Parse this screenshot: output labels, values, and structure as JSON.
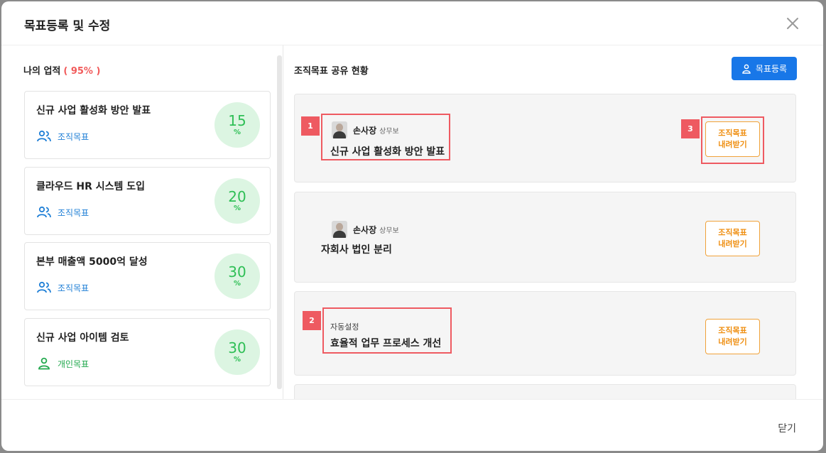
{
  "modal": {
    "title": "목표등록 및 수정",
    "close_label": "닫기"
  },
  "left": {
    "title": "나의 업적",
    "achievement": "( 95% )",
    "goals": [
      {
        "name": "신규 사업 활성화 방안 발표",
        "type": "조직목표",
        "progress": "15",
        "unit": "%"
      },
      {
        "name": "클라우드 HR 시스템 도입",
        "type": "조직목표",
        "progress": "20",
        "unit": "%"
      },
      {
        "name": "본부 매출액 5000억 달성",
        "type": "조직목표",
        "progress": "30",
        "unit": "%"
      },
      {
        "name": "신규 사업 아이템 검토",
        "type": "개인목표",
        "progress": "30",
        "unit": "%"
      }
    ]
  },
  "right": {
    "title": "조직목표 공유 현황",
    "register_label": "목표등록",
    "cards": [
      {
        "owner": "손사장",
        "rank": "상무보",
        "goal": "신규 사업 활성화 방안 발표",
        "button_line1": "조직목표",
        "button_line2": "내려받기"
      },
      {
        "owner": "손사장",
        "rank": "상무보",
        "goal": "자회사 법인 분리",
        "button_line1": "조직목표",
        "button_line2": "내려받기"
      },
      {
        "auto": "자동설정",
        "goal": "효율적 업무 프로세스 개선",
        "button_line1": "조직목표",
        "button_line2": "내려받기"
      }
    ]
  },
  "callouts": [
    "1",
    "2",
    "3"
  ],
  "colors": {
    "primary": "#1877e8",
    "org_goal": "#1f7fd6",
    "personal_goal": "#21a84d",
    "progress": "#2fbf56",
    "accent_orange": "#ef8f12",
    "callout_red": "#ee5a61",
    "percent_red": "#f15b5b"
  },
  "icons": [
    "close-icon",
    "group-icon",
    "user-icon"
  ]
}
